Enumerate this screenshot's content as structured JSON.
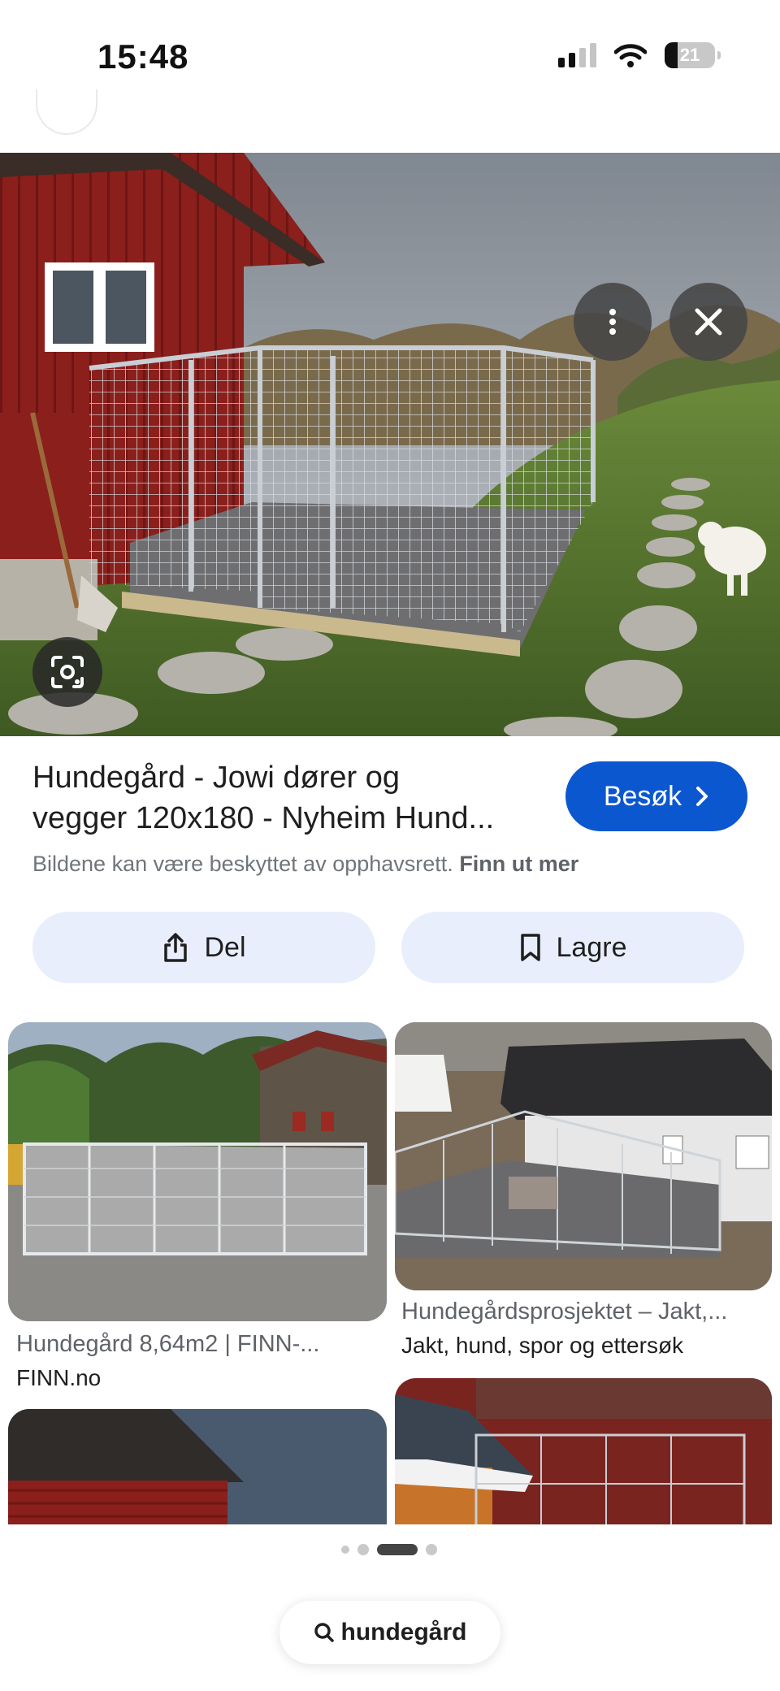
{
  "status_bar": {
    "time": "15:48",
    "battery": "21"
  },
  "result": {
    "title_line1": "Hundegård - Jowi dører og",
    "title_line2": "vegger 120x180 - Nyheim Hund...",
    "visit_label": "Besøk",
    "copyright_text": "Bildene kan være beskyttet av opphavsrett.",
    "learn_more": "Finn ut mer",
    "share_label": "Del",
    "save_label": "Lagre"
  },
  "related": [
    {
      "title": "Hundegård 8,64m2 | FINN-...",
      "source": "FINN.no"
    },
    {
      "title": "Hundegårdsprosjektet – Jakt,...",
      "source": "Jakt, hund, spor og ettersøk"
    }
  ],
  "pager": {
    "pages": 4,
    "active_index": 2
  },
  "search": {
    "query": "hundegård"
  },
  "colors": {
    "accent": "#0b57d0",
    "pill_bg": "#e8eefb",
    "secondary_text": "#5f6368"
  },
  "icons": [
    "signal-icon",
    "wifi-icon",
    "battery-icon",
    "more-vert-icon",
    "close-icon",
    "lens-icon",
    "chevron-right-icon",
    "share-icon",
    "bookmark-icon",
    "search-icon"
  ]
}
